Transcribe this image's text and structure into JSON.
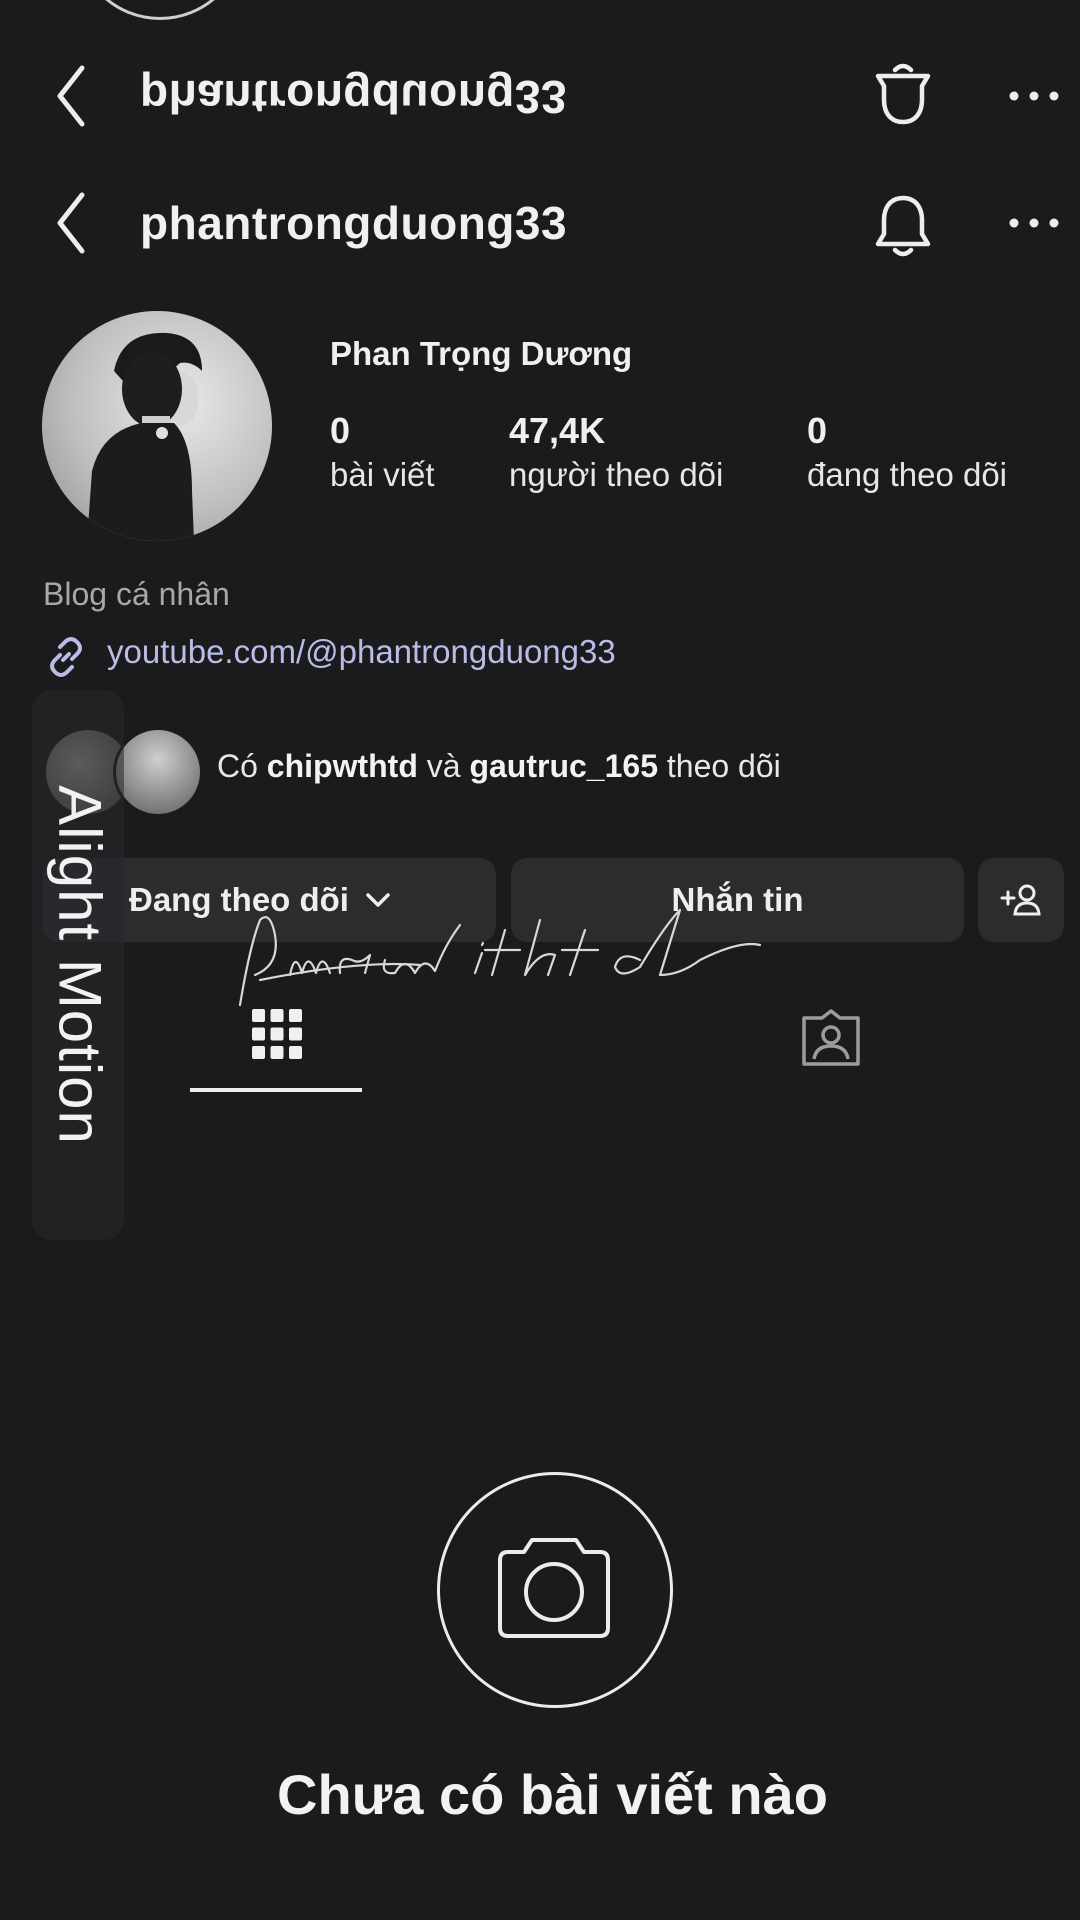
{
  "header": {
    "username": "phantrongduong33",
    "back_icon": "chevron-left-icon",
    "bell_icon": "bell-icon",
    "more_icon": "more-horizontal-icon"
  },
  "profile": {
    "full_name": "Phan Trọng Dương",
    "stats": [
      {
        "value": "0",
        "label": "bài viết"
      },
      {
        "value": "47,4K",
        "label": "người theo dõi"
      },
      {
        "value": "0",
        "label": "đang theo dõi"
      }
    ],
    "category": "Blog cá nhân",
    "link": "youtube.com/@phantrongduong33"
  },
  "mutual": {
    "prefix": "Có ",
    "user1": "chipwthtd",
    "middle": " và ",
    "user2": "gautruc_165",
    "suffix": " theo dõi"
  },
  "actions": {
    "following": "Đang theo dõi",
    "message": "Nhắn tin"
  },
  "watermark": {
    "app": "Alight Motion",
    "signature": "Pimcwithtd"
  },
  "empty_state": {
    "title": "Chưa có bài viết nào"
  },
  "colors": {
    "background": "#1b1b1d",
    "button": "#2c2c2f",
    "link": "#b9bde6",
    "muted": "#a8a8a8"
  }
}
